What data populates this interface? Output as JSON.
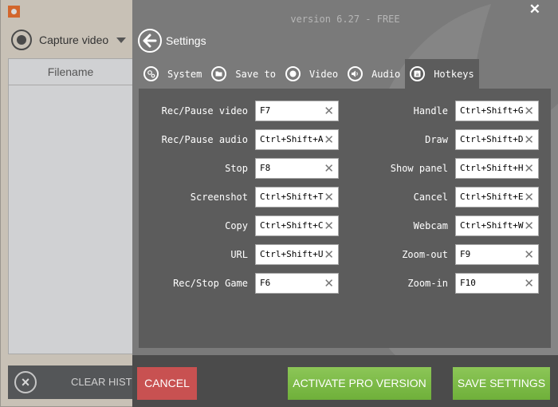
{
  "background_app": {
    "capture_mode": "Capture video",
    "table_header": "Filename",
    "clear_history_label": "CLEAR HISTORY"
  },
  "settings": {
    "version": "version 6.27 - FREE",
    "title": "Settings",
    "tabs": [
      {
        "label": "System",
        "icon": "gears-icon",
        "active": false
      },
      {
        "label": "Save to",
        "icon": "folder-icon",
        "active": false
      },
      {
        "label": "Video",
        "icon": "record-icon",
        "active": false
      },
      {
        "label": "Audio",
        "icon": "speaker-icon",
        "active": false
      },
      {
        "label": "Hotkeys",
        "icon": "keyboard-key-icon",
        "active": true
      }
    ],
    "hotkeys_left": [
      {
        "label": "Rec/Pause video",
        "value": "F7"
      },
      {
        "label": "Rec/Pause audio",
        "value": "Ctrl+Shift+A"
      },
      {
        "label": "Stop",
        "value": "F8"
      },
      {
        "label": "Screenshot",
        "value": "Ctrl+Shift+T"
      },
      {
        "label": "Copy",
        "value": "Ctrl+Shift+C"
      },
      {
        "label": "URL",
        "value": "Ctrl+Shift+U"
      },
      {
        "label": "Rec/Stop Game",
        "value": "F6"
      }
    ],
    "hotkeys_right": [
      {
        "label": "Handle",
        "value": "Ctrl+Shift+G"
      },
      {
        "label": "Draw",
        "value": "Ctrl+Shift+D"
      },
      {
        "label": "Show panel",
        "value": "Ctrl+Shift+H"
      },
      {
        "label": "Cancel",
        "value": "Ctrl+Shift+E"
      },
      {
        "label": "Webcam",
        "value": "Ctrl+Shift+W"
      },
      {
        "label": "Zoom-out",
        "value": "F9"
      },
      {
        "label": "Zoom-in",
        "value": "F10"
      }
    ],
    "buttons": {
      "cancel": "CANCEL",
      "activate_pro": "ACTIVATE PRO VERSION",
      "save": "SAVE SETTINGS"
    },
    "colors": {
      "cancel": "#c85151",
      "green": "#7cbb48",
      "accent_logo": "#d2662c"
    }
  }
}
